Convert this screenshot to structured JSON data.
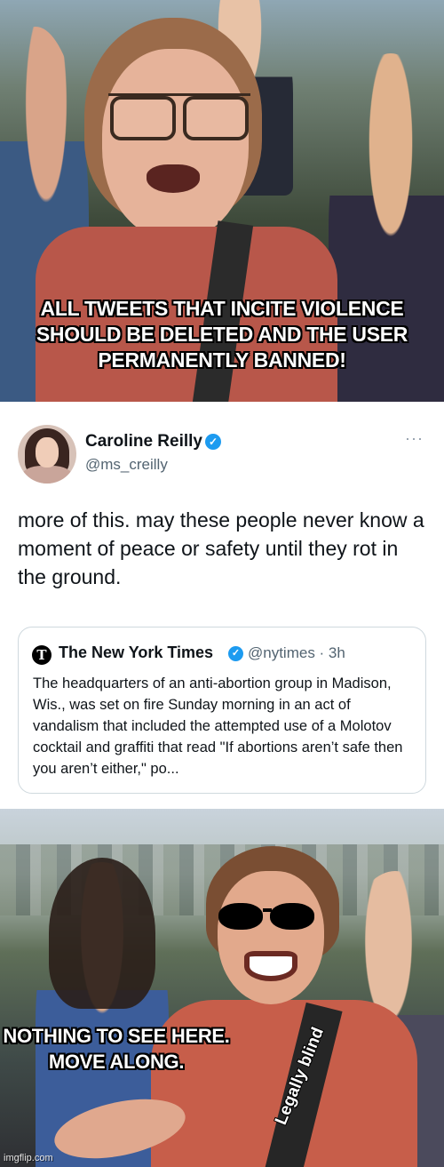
{
  "top_panel": {
    "caption": "ALL TWEETS THAT INCITE VIOLENCE SHOULD BE DELETED AND THE USER PERMANENTLY BANNED!"
  },
  "tweet": {
    "author_name": "Caroline Reilly",
    "handle": "@ms_creilly",
    "body": "more of this. may these people never know a moment of peace or safety until they rot in the ground.",
    "quoted": {
      "author_name": "The New York Times",
      "handle": "@nytimes · 3h",
      "text": "The headquarters of an anti-abortion group in Madison, Wis., was set on fire Sunday morning in an act of vandalism that included the attempted use of a Molotov cocktail and graffiti that read \"If abortions aren’t safe then you aren’t either,\" po..."
    }
  },
  "bottom_panel": {
    "caption": "NOTHING TO SEE HERE. MOVE ALONG.",
    "strap_label": "Legally blind",
    "watermark": "imgflip.com"
  },
  "colors": {
    "verified_blue": "#1d9bf0",
    "tweet_text": "#0f1419",
    "handle_gray": "#536471",
    "card_border": "#cfd9de"
  }
}
